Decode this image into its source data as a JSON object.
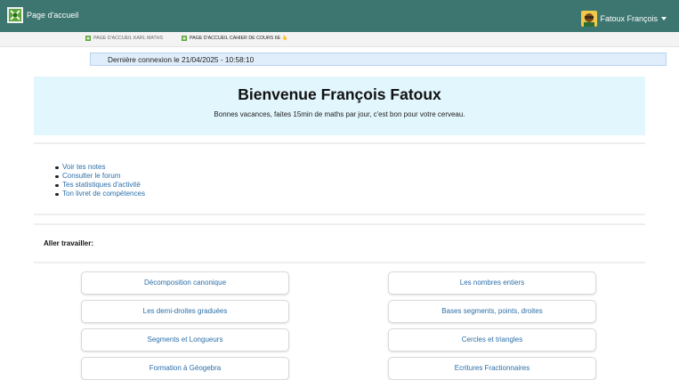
{
  "header": {
    "home_label": "Page d'accueil",
    "user_name": "Fatoux François",
    "colors": {
      "bar": "#3d7670",
      "logo": "#5aa63a"
    }
  },
  "breadcrumbs": [
    {
      "label": "PAGE D'ACCUEIL KARL MATHS"
    },
    {
      "label": "PAGE D'ACCUEIL CAHIER DE COURS 6E 👆"
    }
  ],
  "last_login": "Dernière connexion le 21/04/2025 - 10:58:10",
  "welcome": {
    "title": "Bienvenue François Fatoux",
    "subtitle": "Bonnes vacances, faites 15min de maths par jour, c'est bon pour votre cerveau."
  },
  "links": [
    "Voir tes notes",
    "Consulter le forum",
    "Tes statistiques d'activité",
    "Ton livret de compétences"
  ],
  "work": {
    "label": "Aller travailler:",
    "left": [
      "Décomposition canonique",
      "Les demi-droites graduées",
      "Segments et Longueurs",
      "Formation à Géogebra"
    ],
    "right": [
      "Les nombres entiers",
      "Bases segments, points, droites",
      "Cercles et triangles",
      "Ecritures Fractionnaires"
    ]
  }
}
